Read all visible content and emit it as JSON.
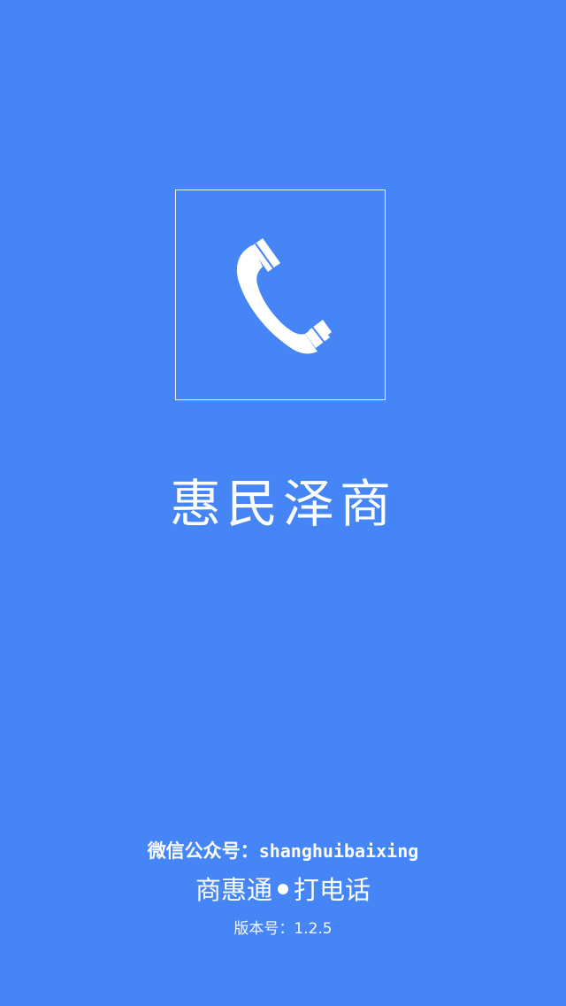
{
  "colors": {
    "background": "#4585f5",
    "foreground": "#ffffff"
  },
  "logo": {
    "icon": "phone-handset-icon"
  },
  "brand": {
    "title": "惠民泽商"
  },
  "footer": {
    "wechat_label": "微信公众号：",
    "wechat_account": "shanghuibaixing",
    "app_name_left": "商惠通",
    "app_name_right": "打电话",
    "version_label": "版本号：",
    "version_number": "1.2.5"
  }
}
